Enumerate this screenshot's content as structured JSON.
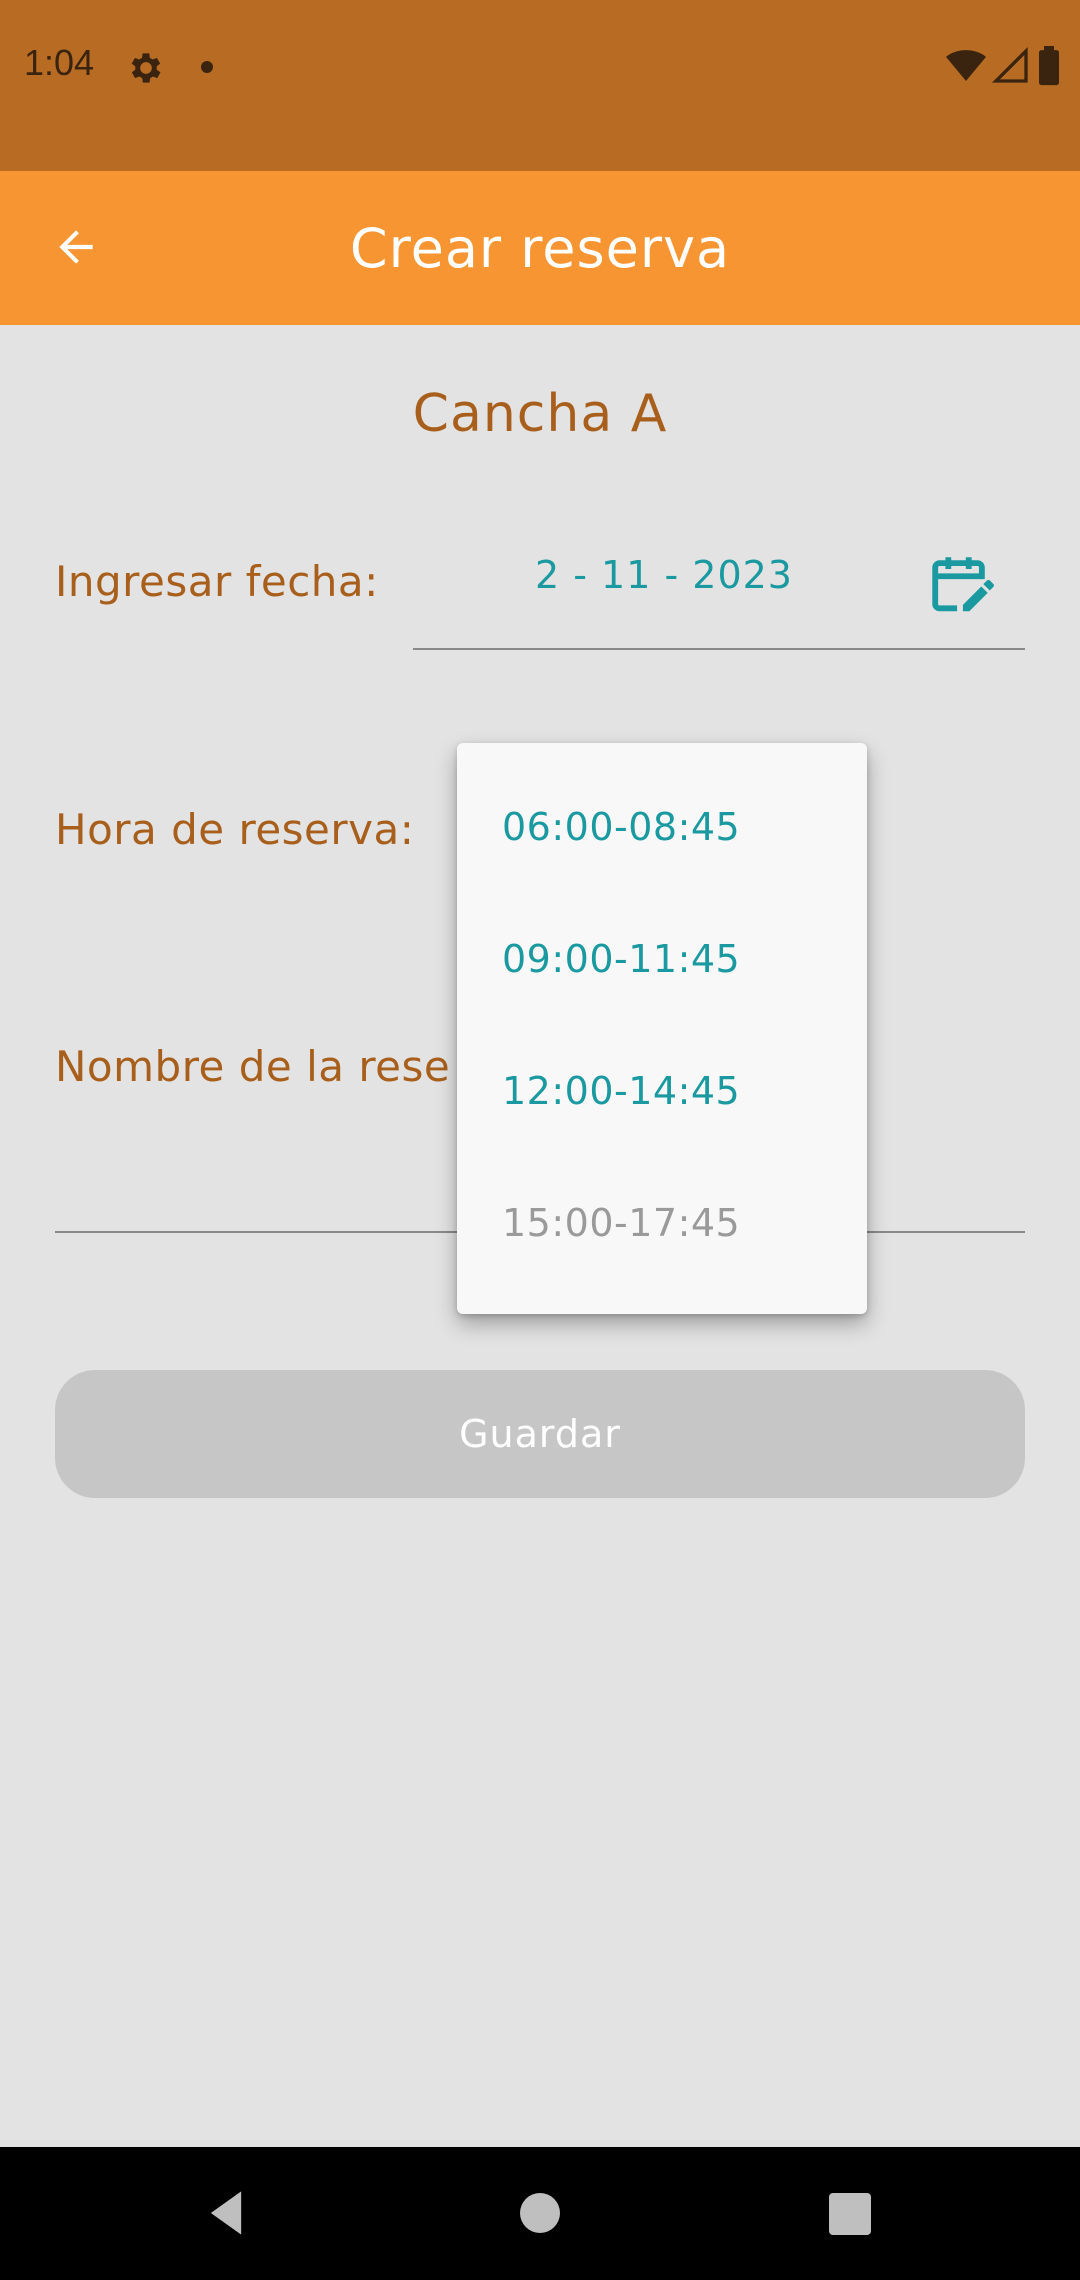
{
  "status_bar": {
    "time": "1:04",
    "icons": [
      "gear-icon",
      "notification-dot-icon",
      "wifi-icon",
      "signal-icon",
      "battery-icon"
    ]
  },
  "app_bar": {
    "title": "Crear reserva",
    "back_icon": "arrow-back-icon",
    "color": "#f79532"
  },
  "form": {
    "court_name": "Cancha A",
    "date_label": "Ingresar fecha:",
    "date_value": "2 - 11 - 2023",
    "calendar_icon": "calendar-edit-icon",
    "time_label": "Hora de reserva:",
    "name_label": "Nombre de la rese",
    "save_label": "Guardar"
  },
  "time_dropdown": {
    "options": [
      {
        "label": "06:00-08:45",
        "enabled": true
      },
      {
        "label": "09:00-11:45",
        "enabled": true
      },
      {
        "label": "12:00-14:45",
        "enabled": true
      },
      {
        "label": "15:00-17:45",
        "enabled": false
      }
    ]
  },
  "nav_bar": {
    "icons": [
      "nav-back-icon",
      "nav-home-icon",
      "nav-recents-icon"
    ]
  },
  "colors": {
    "accent": "#f79532",
    "status_bar": "#b86c23",
    "label_text": "#a85f1c",
    "value_text": "#1a9aa0",
    "disabled_text": "#9a9a9a",
    "button_disabled": "#c6c6c6"
  }
}
